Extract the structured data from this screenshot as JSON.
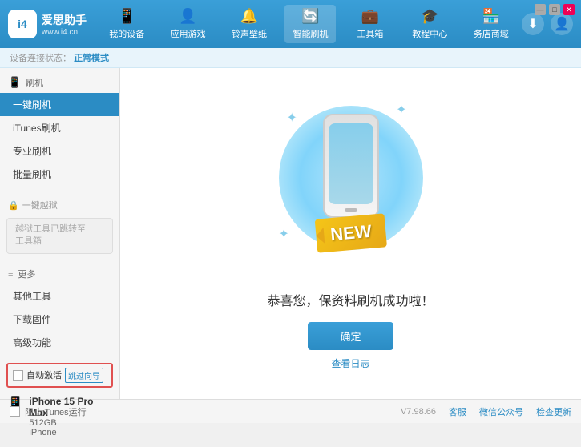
{
  "app": {
    "logo_text": "爱思助手",
    "logo_url": "www.i4.cn",
    "logo_initial": "i4"
  },
  "header": {
    "nav": [
      {
        "id": "my-device",
        "label": "我的设备",
        "icon": "📱"
      },
      {
        "id": "apps-games",
        "label": "应用游戏",
        "icon": "👤"
      },
      {
        "id": "ringtones",
        "label": "铃声壁纸",
        "icon": "🔔"
      },
      {
        "id": "smart-flash",
        "label": "智能刷机",
        "icon": "🔄",
        "active": true
      },
      {
        "id": "toolbox",
        "label": "工具箱",
        "icon": "💼"
      },
      {
        "id": "tutorial",
        "label": "教程中心",
        "icon": "🎓"
      },
      {
        "id": "business",
        "label": "务店商域",
        "icon": "🏪"
      }
    ]
  },
  "status_bar": {
    "prefix": "设备连接状态：",
    "value": "正常模式"
  },
  "sidebar": {
    "group_flash": {
      "icon": "📱",
      "label": "刷机",
      "items": [
        {
          "id": "one-key-flash",
          "label": "一键刷机",
          "active": true
        },
        {
          "id": "itunes-flash",
          "label": "iTunes刷机"
        },
        {
          "id": "pro-flash",
          "label": "专业刷机"
        },
        {
          "id": "batch-flash",
          "label": "批量刷机"
        }
      ]
    },
    "group_locked": {
      "icon": "🔒",
      "label": "一键越狱",
      "locked_hint": "越狱工具已跳转至\n工具箱"
    },
    "group_more": {
      "label": "更多",
      "items": [
        {
          "id": "other-tools",
          "label": "其他工具"
        },
        {
          "id": "download-firmware",
          "label": "下载固件"
        },
        {
          "id": "advanced",
          "label": "高级功能"
        }
      ]
    },
    "auto_activate": {
      "checkbox_label": "自动激活",
      "time_btn_label": "跳过向导"
    },
    "device": {
      "name": "iPhone 15 Pro Max",
      "storage": "512GB",
      "type": "iPhone"
    }
  },
  "content": {
    "new_text": "NEW",
    "success_message": "恭喜您，保资料刷机成功啦！",
    "confirm_btn": "确定",
    "log_link": "查看日志"
  },
  "footer": {
    "stop_itunes": "阻止iTunes运行",
    "version": "V7.98.66",
    "links": [
      "客服",
      "微信公众号",
      "检查更新"
    ]
  },
  "win_controls": {
    "min": "—",
    "max": "□",
    "close": "✕"
  }
}
